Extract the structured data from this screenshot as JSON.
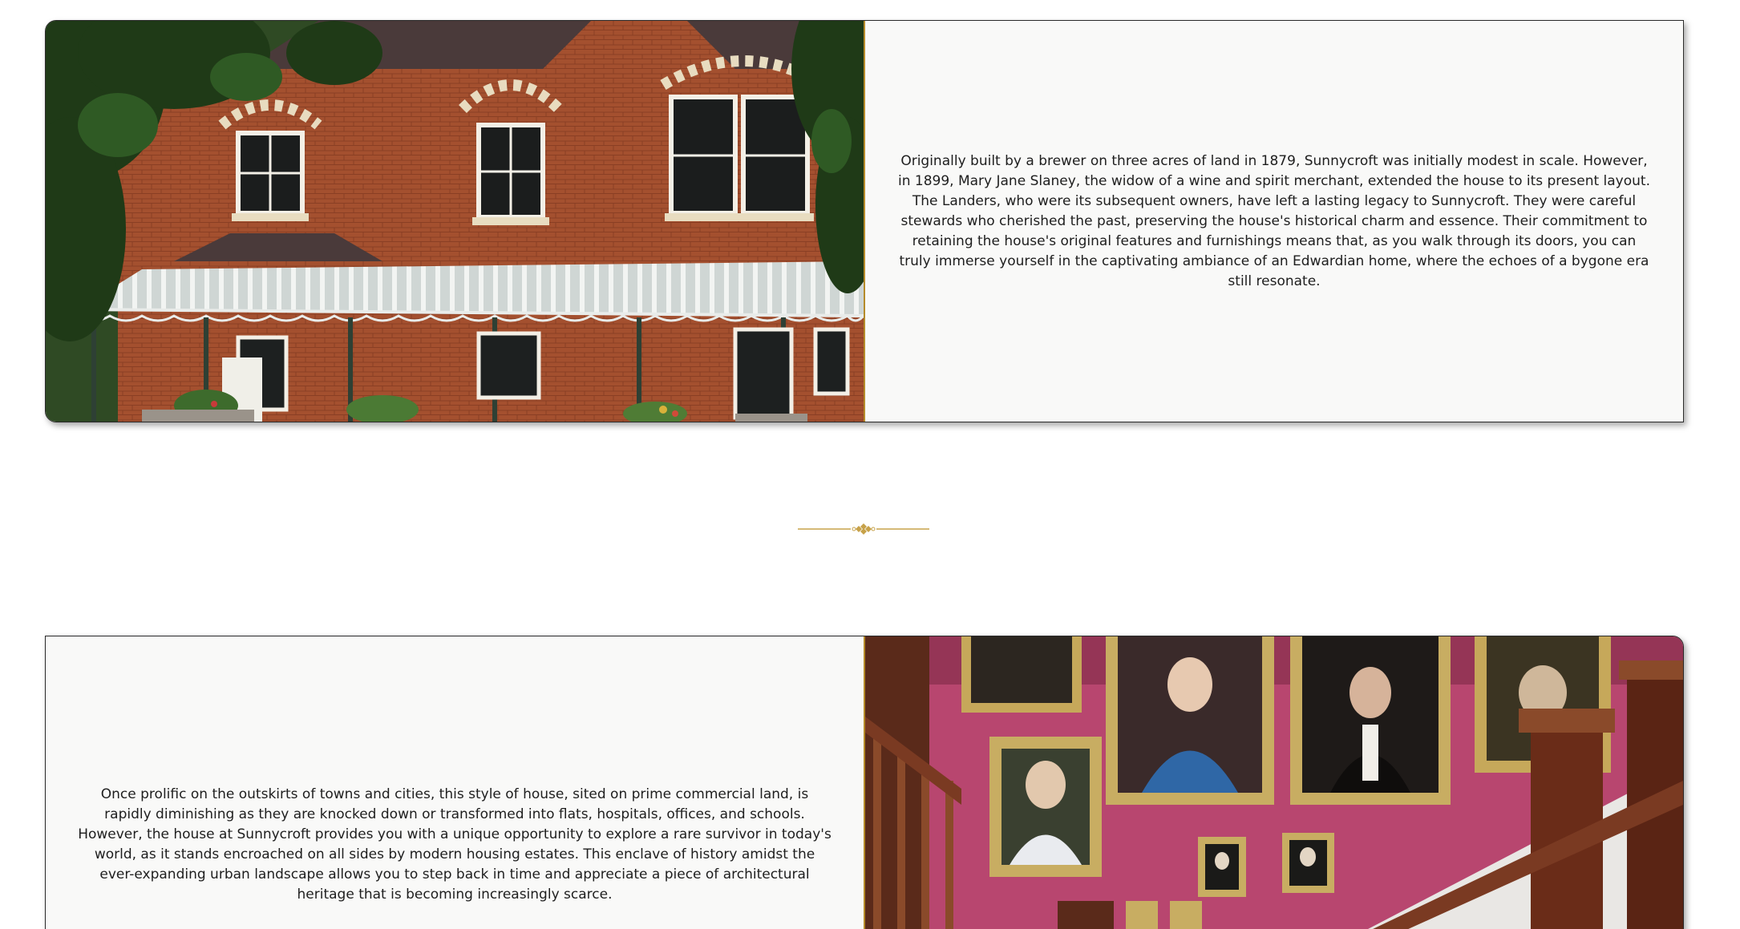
{
  "sections": [
    {
      "image_alt": "Sunnycroft house exterior with red brick facade and glass veranda",
      "text": "Originally built by a brewer on three acres of land in 1879, Sunnycroft was initially modest in scale. However, in 1899, Mary Jane Slaney, the widow of a wine and spirit merchant, extended the house to its present layout. The Landers, who were its subsequent owners, have left a lasting legacy to Sunnycroft. They were careful stewards who cherished the past, preserving the house's historical charm and essence. Their commitment to retaining the house's original features and furnishings means that, as you walk through its doors, you can truly immerse yourself in the captivating ambiance of an Edwardian home, where the echoes of a bygone era still resonate."
    },
    {
      "image_alt": "Staircase with pink walls and framed portrait paintings",
      "text": "Once prolific on the outskirts of towns and cities, this style of house, sited on prime commercial land, is rapidly diminishing as they are knocked down or transformed into flats, hospitals, offices, and schools. However, the house at Sunnycroft provides you with a unique opportunity to explore a rare survivor in today's world, as it stands encroached on all sides by modern housing estates. This enclave of history amidst the ever-expanding urban landscape allows you to step back in time and appreciate a piece of architectural heritage that is becoming increasingly scarce."
    }
  ],
  "colors": {
    "accent_gold": "#b58b2a",
    "panel_bg": "#f9f9f8",
    "text": "#1e1e1e"
  }
}
